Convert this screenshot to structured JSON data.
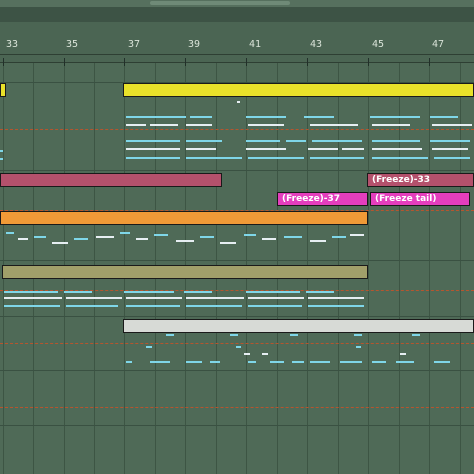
{
  "ruler": {
    "bars": [
      "33",
      "35",
      "37",
      "39",
      "41",
      "43",
      "45",
      "47"
    ]
  },
  "clips": {
    "freeze_37": "(Freeze)-37",
    "freeze_33": "(Freeze)-33",
    "freeze_tail": "(Freeze tail)"
  },
  "colors": {
    "background": "#4f6a57",
    "yellow_clip": "#e9e12a",
    "rose_clip": "#b4516c",
    "magenta_clip": "#e43ebd",
    "orange_clip": "#f09a37",
    "olive_clip": "#a19f6a",
    "white_clip": "#d7dad6",
    "midi_note": "#7fd6e8",
    "loop_dash": "#b6552e"
  }
}
